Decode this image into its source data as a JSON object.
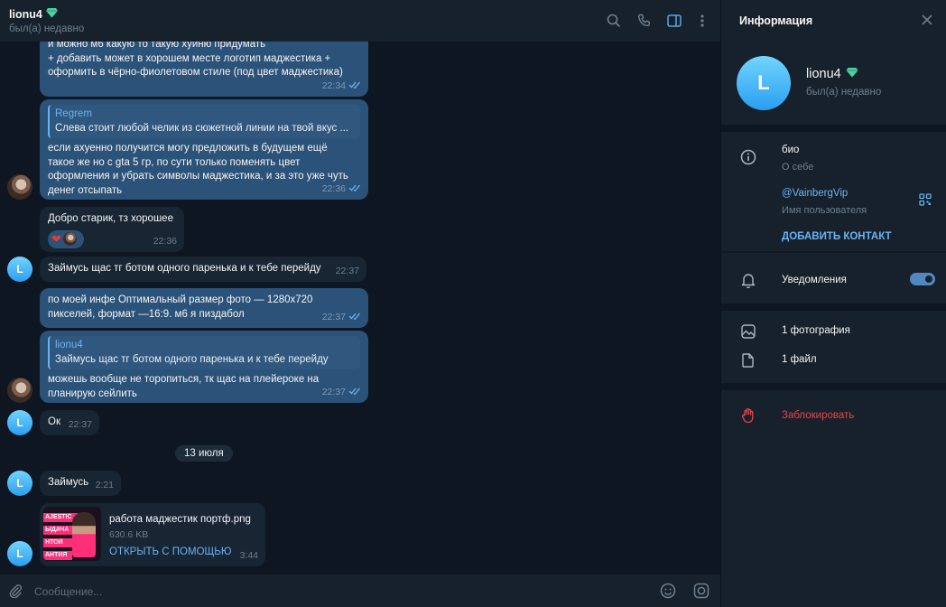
{
  "header": {
    "name": "lionu4",
    "status": "был(а) недавно"
  },
  "messages": [
    {
      "text": "и можно м6 какую то такую хуйню придумать\n+ добавить может в хорошем месте логотип маджестика +\nоформить в чёрно-фиолетовом стиле (под цвет маджестика)",
      "time": "22:34"
    },
    {
      "reply_name": "Regrem",
      "reply_text": "Слева стоит любой челик из сюжетной линии на твой вкус ...",
      "text": "если ахуенно получится могу предложить в будущем ещё\nтакое же но с gta 5 гр, по сути только поменять цвет\nоформления и убрать символы маджестика, и за это уже чуть\nденег отсыпать",
      "time": "22:36"
    },
    {
      "text": "Добро старик, тз хорошее",
      "time": "22:36",
      "reaction": "❤"
    },
    {
      "text": "Займусь щас тг ботом одного паренька и к тебе перейду",
      "time": "22:37",
      "avatar": "L"
    },
    {
      "text": "по моей инфе Оптимальный размер фото — 1280x720\nпикселей, формат —16:9. м6 я пиздабол",
      "time": "22:37"
    },
    {
      "reply_name": "lionu4",
      "reply_text": "Займусь щас тг ботом одного паренька и к тебе перейду",
      "text": "можешь вообще не торопиться, тк щас на плейероке на\nпланирую сейлить",
      "time": "22:37"
    },
    {
      "text": "Ок",
      "time": "22:37",
      "avatar": "L"
    },
    {
      "text": "Займусь",
      "time": "2:21",
      "avatar": "L"
    },
    {
      "file_name": "работа маджестик портф.png",
      "file_size": "630.6 KB",
      "open_with": "ОТКРЫТЬ С ПОМОЩЬЮ",
      "time": "3:44",
      "avatar": "L",
      "thumb_lines": [
        "AJESTIC",
        "ЫДАЧА",
        "НТОЙ",
        "АНТИЯ"
      ]
    }
  ],
  "date_separator": "13 июля",
  "composer": {
    "placeholder": "Сообщение..."
  },
  "info": {
    "title": "Информация",
    "avatar_letter": "L",
    "name": "lionu4",
    "status": "был(а) недавно",
    "bio_label": "био",
    "bio_sub": "О себе",
    "username": "@VainbergVip",
    "username_sub": "Имя пользователя",
    "add_contact": "ДОБАВИТЬ КОНТАКТ",
    "notifications": "Уведомления",
    "notifications_on": true,
    "photos": "1 фотография",
    "files": "1 файл",
    "block": "Заблокировать"
  },
  "colors": {
    "accent": "#6ab3f3",
    "outgoing_bubble": "#2b5278",
    "incoming_bubble": "#182533",
    "danger": "#e5454c"
  }
}
